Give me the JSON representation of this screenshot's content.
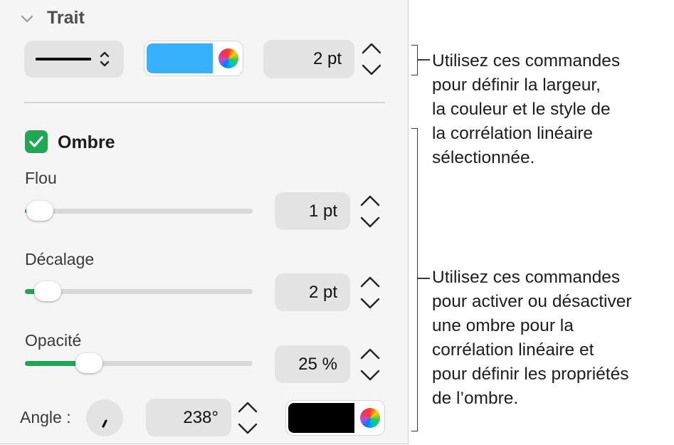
{
  "stroke": {
    "title": "Trait",
    "width_value": "2 pt",
    "color": "#38b1fc"
  },
  "shadow": {
    "enabled": true,
    "title": "Ombre",
    "blur": {
      "label": "Flou",
      "value": "1 pt",
      "level": 0.03
    },
    "offset": {
      "label": "Décalage",
      "value": "2 pt",
      "level": 0.1
    },
    "opacity": {
      "label": "Opacité",
      "value": "25 %",
      "level": 0.28
    },
    "angle": {
      "label": "Angle :",
      "value": "238°"
    },
    "color": "#000000"
  },
  "annotations": {
    "stroke_lines": [
      "Utilisez ces commandes",
      "pour définir la largeur,",
      "la couleur et le style de",
      "la corrélation linéaire",
      "sélectionnée."
    ],
    "shadow_lines": [
      "Utilisez ces commandes",
      "pour activer ou désactiver",
      "une ombre pour la",
      "corrélation linéaire et",
      "pour définir les propriétés",
      "de l’ombre."
    ]
  },
  "colors": {
    "accent_green": "#21a653",
    "panel_bg": "#f5f5f5",
    "field_bg": "#e3e3e3"
  }
}
